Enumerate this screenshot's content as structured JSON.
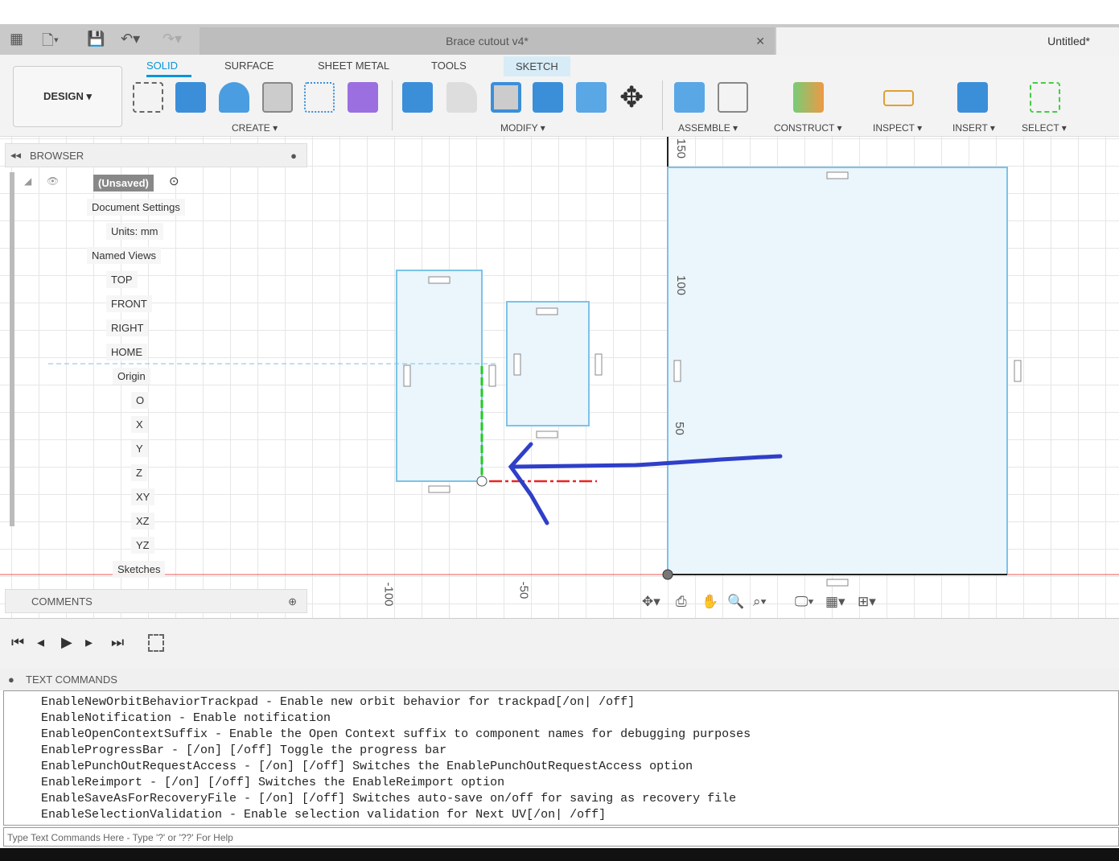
{
  "title_bar": {
    "document_tab": "Brace cutout v4*",
    "other_tab": "Untitled*"
  },
  "toolbar": {
    "workspace": "DESIGN ▾",
    "tabs": [
      "SOLID",
      "SURFACE",
      "SHEET METAL",
      "TOOLS",
      "SKETCH"
    ],
    "active_tab": "SOLID",
    "groups": [
      "CREATE ▾",
      "MODIFY ▾",
      "ASSEMBLE ▾",
      "CONSTRUCT ▾",
      "INSPECT ▾",
      "INSERT ▾",
      "SELECT ▾"
    ]
  },
  "browser": {
    "title": "BROWSER",
    "root": "(Unsaved)",
    "items": [
      "Document Settings",
      "Units: mm",
      "Named Views",
      "TOP",
      "FRONT",
      "RIGHT",
      "HOME",
      "Origin",
      "O",
      "X",
      "Y",
      "Z",
      "XY",
      "XZ",
      "YZ",
      "Sketches"
    ]
  },
  "comments": {
    "title": "COMMENTS"
  },
  "axis_labels": {
    "v150": "150",
    "v100": "100",
    "v50": "50",
    "hm100": "-100",
    "hm50": "-50"
  },
  "text_commands": {
    "title": "TEXT COMMANDS",
    "lines": [
      "EnableNewOrbitBehaviorTrackpad - Enable new orbit behavior for trackpad[/on| /off]",
      "EnableNotification - Enable notification",
      "EnableOpenContextSuffix - Enable the Open Context suffix to component names for debugging purposes",
      "EnableProgressBar - [/on] [/off] Toggle the progress bar",
      "EnablePunchOutRequestAccess - [/on] [/off] Switches the EnablePunchOutRequestAccess option",
      "EnableReimport - [/on] [/off] Switches the EnableReimport option",
      "EnableSaveAsForRecoveryFile - [/on] [/off] Switches auto-save on/off for saving as recovery file",
      "EnableSelectionValidation - Enable selection validation for Next UV[/on| /off]"
    ],
    "placeholder": "Type Text Commands Here - Type '?' or '??' For Help"
  },
  "colors": {
    "accent": "#0696d7",
    "sketch_fill": "#eaf5fc",
    "sketch_line": "#7cc3e8",
    "annotation": "#2f3fc8"
  }
}
